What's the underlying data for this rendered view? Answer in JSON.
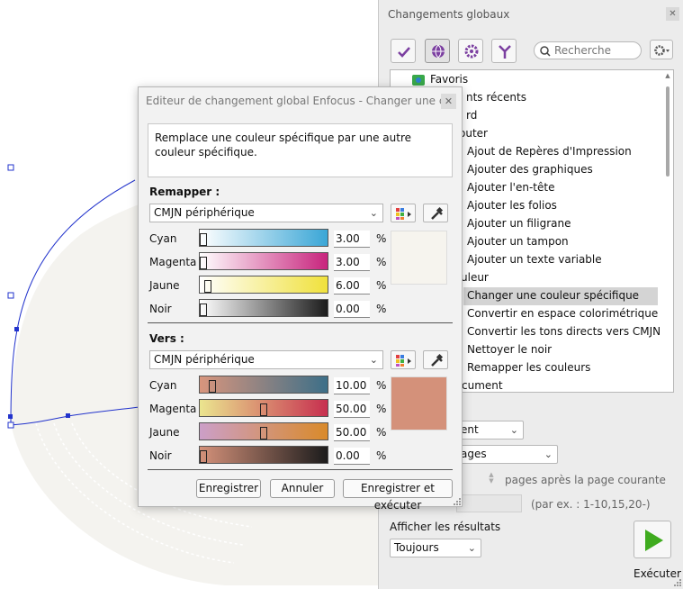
{
  "panel": {
    "title": "Changements globaux",
    "close": "✕",
    "search_placeholder": "Recherche",
    "tree": [
      {
        "label": "Favoris"
      },
      {
        "label": "nts récents"
      },
      {
        "label": "rd"
      },
      {
        "label": "outer"
      },
      {
        "label": "Ajout de Repères d'Impression"
      },
      {
        "label": "Ajouter des graphiques"
      },
      {
        "label": "Ajouter l'en-tête"
      },
      {
        "label": "Ajouter les folios"
      },
      {
        "label": "Ajouter un filigrane"
      },
      {
        "label": "Ajouter un tampon"
      },
      {
        "label": "Ajouter un texte variable"
      },
      {
        "label": "uleur"
      },
      {
        "label": "Changer une couleur spécifique"
      },
      {
        "label": "Convertir en espace colorimétrique"
      },
      {
        "label": "Convertir les tons directs vers CMJN"
      },
      {
        "label": "Nettoyer le noir"
      },
      {
        "label": "Remapper les couleurs"
      },
      {
        "label": "cument"
      }
    ],
    "combo1": "ent",
    "combo2": "ages",
    "pages_after": "pages après la page courante",
    "example_hint": "(par ex. : 1-10,15,20-)",
    "show_results_label": "Afficher les résultats",
    "show_results_value": "Toujours",
    "run_label": "Exécuter"
  },
  "dialog": {
    "title": "Editeur de changement global Enfocus - Changer une couleu...",
    "close": "✕",
    "description": "Remplace une couleur spécifique par une autre couleur spécifique.",
    "remap": {
      "label": "Remapper :",
      "colorspace": "CMJN périphérique",
      "rows": [
        {
          "name": "Cyan",
          "value": "3.00",
          "level": 0.03
        },
        {
          "name": "Magenta",
          "value": "3.00",
          "level": 0.03
        },
        {
          "name": "Jaune",
          "value": "6.00",
          "level": 0.06
        },
        {
          "name": "Noir",
          "value": "0.00",
          "level": 0.0
        }
      ],
      "swatch_color": "#f6f4ee"
    },
    "to": {
      "label": "Vers :",
      "colorspace": "CMJN périphérique",
      "rows": [
        {
          "name": "Cyan",
          "value": "10.00",
          "level": 0.1
        },
        {
          "name": "Magenta",
          "value": "50.00",
          "level": 0.5
        },
        {
          "name": "Jaune",
          "value": "50.00",
          "level": 0.5
        },
        {
          "name": "Noir",
          "value": "0.00",
          "level": 0.0
        }
      ],
      "swatch_color": "#d4917a"
    },
    "percent": "%",
    "buttons": {
      "save": "Enregistrer",
      "cancel": "Annuler",
      "save_run": "Enregistrer et exécuter"
    }
  }
}
